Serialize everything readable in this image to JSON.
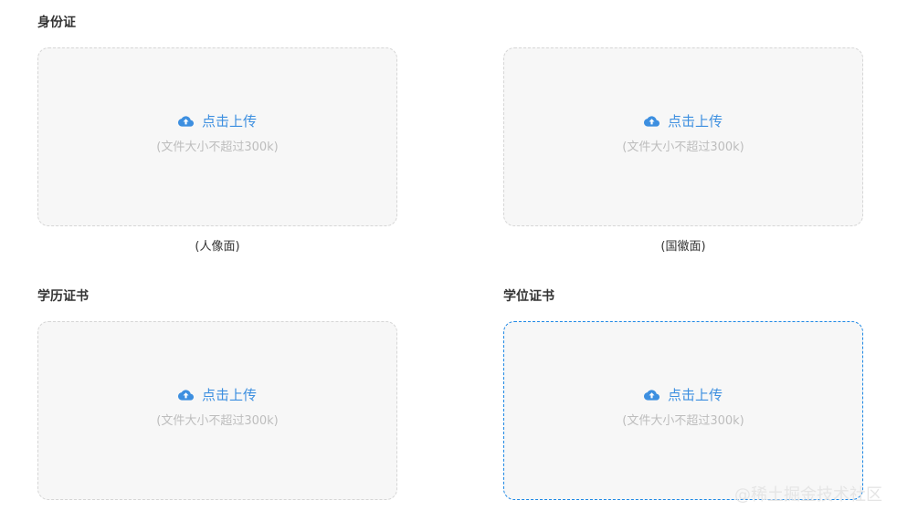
{
  "sections": {
    "id_card": {
      "title": "身份证"
    },
    "education_cert": {
      "title": "学历证书"
    },
    "degree_cert": {
      "title": "学位证书"
    }
  },
  "upload": {
    "action_label": "点击上传",
    "hint": "(文件大小不超过300k)",
    "icon": "cloud-upload-icon",
    "accent_color": "#3d8fe0",
    "active_border_color": "#1e88e5"
  },
  "captions": {
    "portrait": "(人像面)",
    "emblem": "(国徽面)"
  },
  "watermark": "@稀土掘金技术社区"
}
